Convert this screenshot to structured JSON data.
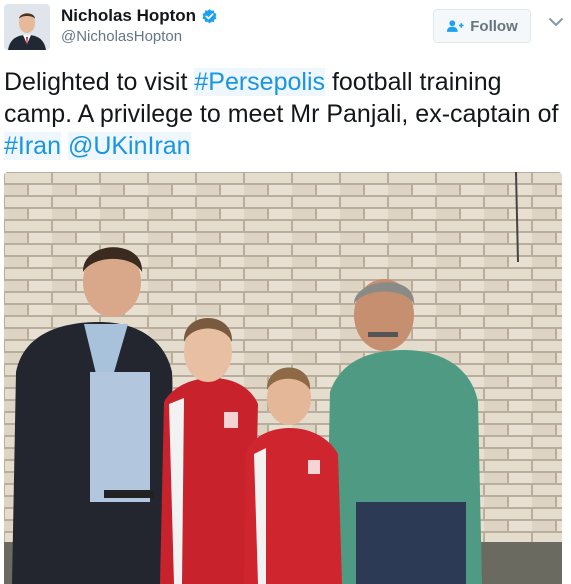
{
  "user": {
    "display_name": "Nicholas Hopton",
    "handle": "@NicholasHopton",
    "verified": true,
    "avatar_icon": "user-avatar"
  },
  "follow_button": {
    "label": "Follow",
    "icon": "add-user-icon"
  },
  "menu_caret": {
    "icon": "chevron-down-icon"
  },
  "tweet": {
    "segments": [
      {
        "text": "Delighted to visit ",
        "link": false
      },
      {
        "text": "#Persepolis",
        "link": true
      },
      {
        "text": " football training camp. A privilege to meet Mr Panjali, ex-captain of ",
        "link": false
      },
      {
        "text": "#Iran",
        "link": true
      },
      {
        "text": " ",
        "link": false
      },
      {
        "text": "@UKinIran",
        "link": true
      }
    ]
  },
  "colors": {
    "link": "#1b95e0",
    "verified_badge": "#1da1f2",
    "text": "#14171a",
    "muted": "#657786"
  }
}
